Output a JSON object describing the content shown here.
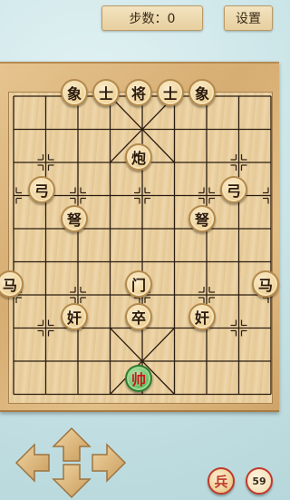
{
  "header": {
    "steps_label": "步数：0",
    "settings_label": "设置"
  },
  "board": {
    "pieces": [
      {
        "label": "象",
        "col": 3,
        "row": 0,
        "side": "black",
        "name": "piece-elephant-left"
      },
      {
        "label": "士",
        "col": 4,
        "row": 0,
        "side": "black",
        "name": "piece-advisor-left"
      },
      {
        "label": "将",
        "col": 5,
        "row": 0,
        "side": "black",
        "name": "piece-general"
      },
      {
        "label": "士",
        "col": 6,
        "row": 0,
        "side": "black",
        "name": "piece-advisor-right"
      },
      {
        "label": "象",
        "col": 7,
        "row": 0,
        "side": "black",
        "name": "piece-elephant-right"
      },
      {
        "label": "炮",
        "col": 5,
        "row": 2,
        "side": "black",
        "name": "piece-cannon"
      },
      {
        "label": "弓",
        "col": 1,
        "row": 3,
        "side": "black",
        "name": "piece-bow-left"
      },
      {
        "label": "弓",
        "col": 9,
        "row": 3,
        "side": "black",
        "name": "piece-bow-right"
      },
      {
        "label": "弩",
        "col": 2,
        "row": 4,
        "side": "black",
        "name": "piece-crossbow-left"
      },
      {
        "label": "弩",
        "col": 8,
        "row": 4,
        "side": "black",
        "name": "piece-crossbow-right"
      },
      {
        "label": "马",
        "col": 0,
        "row": 6,
        "side": "black",
        "name": "piece-horse-left"
      },
      {
        "label": "门",
        "col": 5,
        "row": 6,
        "side": "black",
        "name": "piece-gate"
      },
      {
        "label": "马",
        "col": 10,
        "row": 6,
        "side": "black",
        "name": "piece-horse-right"
      },
      {
        "label": "奸",
        "col": 2,
        "row": 7,
        "side": "black",
        "name": "piece-traitor-left"
      },
      {
        "label": "卒",
        "col": 5,
        "row": 7,
        "side": "black",
        "name": "piece-soldier"
      },
      {
        "label": "奸",
        "col": 8,
        "row": 7,
        "side": "black",
        "name": "piece-traitor-right"
      },
      {
        "label": "帅",
        "col": 5,
        "row": 9,
        "side": "red",
        "name": "piece-marshal"
      }
    ]
  },
  "controls": {
    "up_icon": "arrow-up-icon",
    "down_icon": "arrow-down-icon",
    "left_icon": "arrow-left-icon",
    "right_icon": "arrow-right-icon"
  },
  "bottom": {
    "soldier_label": "兵",
    "count_label": "59"
  }
}
